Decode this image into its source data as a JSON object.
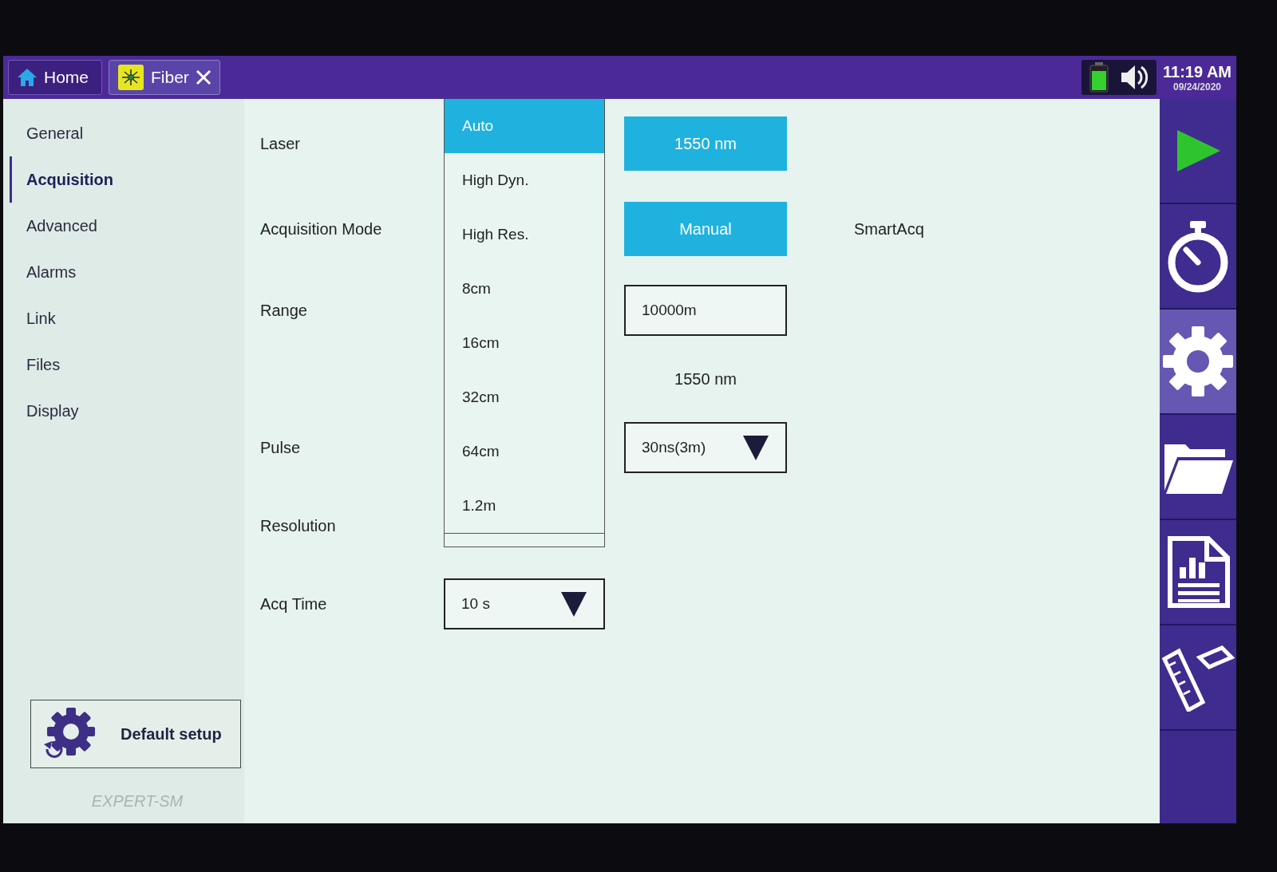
{
  "top_bar": {
    "tabs": [
      {
        "kind": "home",
        "label": "Home",
        "selected": false,
        "closable": false
      },
      {
        "kind": "fiber",
        "label": "Fiber",
        "selected": true,
        "closable": true
      }
    ],
    "time": "11:19 AM",
    "date": "09/24/2020"
  },
  "sidebar": {
    "items": [
      {
        "label": "General",
        "selected": false
      },
      {
        "label": "Acquisition",
        "selected": true
      },
      {
        "label": "Advanced",
        "selected": false
      },
      {
        "label": "Alarms",
        "selected": false
      },
      {
        "label": "Link",
        "selected": false
      },
      {
        "label": "Files",
        "selected": false
      },
      {
        "label": "Display",
        "selected": false
      }
    ],
    "default_button": "Default setup",
    "model": "EXPERT-SM"
  },
  "form": {
    "laser": {
      "label": "Laser",
      "options": [
        {
          "label": "1550 nm",
          "selected": true
        }
      ]
    },
    "acquisition_mode": {
      "label": "Acquisition Mode",
      "options": [
        {
          "label": "Manual",
          "selected": true
        },
        {
          "label": "SmartAcq",
          "selected": false
        }
      ]
    },
    "range": {
      "label": "Range",
      "value": "10000m"
    },
    "wavelength_note": "1550 nm",
    "pulse": {
      "label": "Pulse",
      "value": "30ns(3m)"
    },
    "resolution": {
      "label": "Resolution",
      "open_list": [
        {
          "label": "Auto",
          "selected": true
        },
        {
          "label": "High Dyn.",
          "selected": false
        },
        {
          "label": "High Res.",
          "selected": false
        },
        {
          "label": "8cm",
          "selected": false
        },
        {
          "label": "16cm",
          "selected": false
        },
        {
          "label": "32cm",
          "selected": false
        },
        {
          "label": "64cm",
          "selected": false
        },
        {
          "label": "1.2m",
          "selected": false
        }
      ]
    },
    "acq_time": {
      "label": "Acq Time",
      "value": "10 s"
    }
  },
  "tool_rail": {
    "tools": [
      {
        "kind": "play",
        "selected": false
      },
      {
        "kind": "timer",
        "selected": false
      },
      {
        "kind": "settings",
        "selected": true
      },
      {
        "kind": "folder",
        "selected": false
      },
      {
        "kind": "report",
        "selected": false
      },
      {
        "kind": "ruler",
        "selected": false
      }
    ]
  }
}
